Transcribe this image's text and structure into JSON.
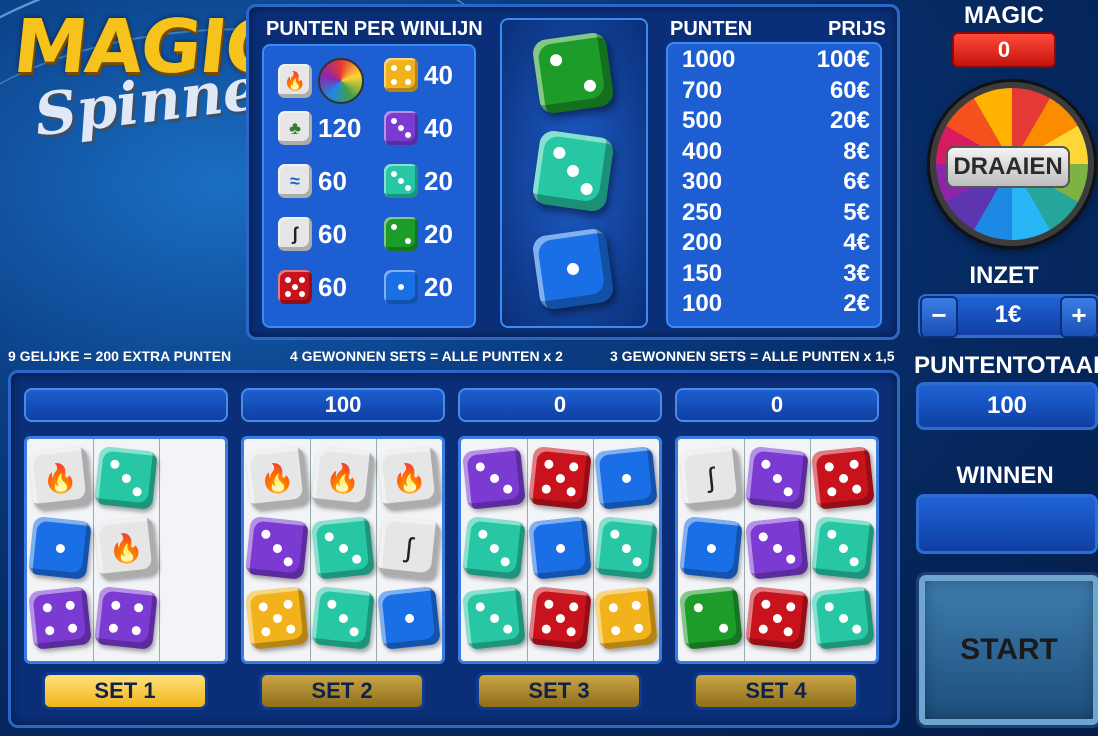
{
  "logo": {
    "line1": "MAGIC",
    "line2": "Spinner"
  },
  "points_per_line": {
    "title": "PUNTEN PER WINLIJN",
    "rows": [
      {
        "left_icon": "flame-die-icon",
        "left_icon2": "wheel-icon",
        "left_value": "",
        "right_icon": "yellow-die-icon",
        "right_value": "40"
      },
      {
        "left_icon": "leaf-die-icon",
        "left_value": "120",
        "right_icon": "purple-die-icon",
        "right_value": "40"
      },
      {
        "left_icon": "water-die-icon",
        "left_value": "60",
        "right_icon": "teal-die-icon",
        "right_value": "20"
      },
      {
        "left_icon": "wind-die-icon",
        "left_value": "60",
        "right_icon": "green-die-icon",
        "right_value": "20"
      },
      {
        "left_icon": "red-die-icon",
        "left_value": "60",
        "right_icon": "blue-die-icon",
        "right_value": "20"
      }
    ]
  },
  "reel_dice": [
    {
      "color": "#1e9c2a",
      "pips": 2
    },
    {
      "color": "#27c7a6",
      "pips": 3
    },
    {
      "color": "#1a6fe6",
      "pips": 1
    }
  ],
  "paytable": {
    "col_points": "PUNTEN",
    "col_prize": "PRIJS",
    "rows": [
      {
        "points": "1000",
        "prize": "100€"
      },
      {
        "points": "700",
        "prize": "60€"
      },
      {
        "points": "500",
        "prize": "20€"
      },
      {
        "points": "400",
        "prize": "8€"
      },
      {
        "points": "300",
        "prize": "6€"
      },
      {
        "points": "250",
        "prize": "5€"
      },
      {
        "points": "200",
        "prize": "4€"
      },
      {
        "points": "150",
        "prize": "3€"
      },
      {
        "points": "100",
        "prize": "2€"
      }
    ]
  },
  "info": {
    "nine_equal": "9 GELIJKE = 200 EXTRA PUNTEN",
    "four_sets": "4 GEWONNEN SETS = ALLE PUNTEN x 2",
    "three_sets": "3 GEWONNEN SETS = ALLE PUNTEN x 1,5"
  },
  "sets": [
    {
      "label": "SET 1",
      "score": "",
      "active": true,
      "cells": [
        [
          "flame",
          "teal3",
          null
        ],
        [
          "blue1",
          "flame",
          null
        ],
        [
          "purple4",
          "purple4",
          null
        ]
      ]
    },
    {
      "label": "SET 2",
      "score": "100",
      "active": false,
      "cells": [
        [
          "flame",
          "flame",
          "flame"
        ],
        [
          "purple3",
          "teal3",
          "wind"
        ],
        [
          "yellow5",
          "teal3",
          "blue1"
        ]
      ]
    },
    {
      "label": "SET 3",
      "score": "0",
      "active": false,
      "cells": [
        [
          "purple3",
          "red5",
          "blue1"
        ],
        [
          "teal3",
          "blue1",
          "teal3"
        ],
        [
          "teal3",
          "red5",
          "yellow4"
        ]
      ]
    },
    {
      "label": "SET 4",
      "score": "0",
      "active": false,
      "cells": [
        [
          "wind",
          "purple3",
          "red5"
        ],
        [
          "blue1",
          "purple3",
          "teal3"
        ],
        [
          "green2",
          "red5",
          "teal3"
        ]
      ]
    }
  ],
  "magic": {
    "label": "MAGIC",
    "value": "0"
  },
  "wheel": {
    "button": "DRAAIEN"
  },
  "bet": {
    "label": "INZET",
    "value": "1€",
    "minus": "−",
    "plus": "+"
  },
  "total": {
    "label": "PUNTENTOTAAL",
    "value": "100"
  },
  "win": {
    "label": "WINNEN",
    "value": ""
  },
  "start": {
    "label": "START"
  },
  "colors": {
    "panel": "#0a2f78",
    "accent": "#1d5ed3",
    "gold": "#f0b51a",
    "magic_red": "#e0201a"
  }
}
